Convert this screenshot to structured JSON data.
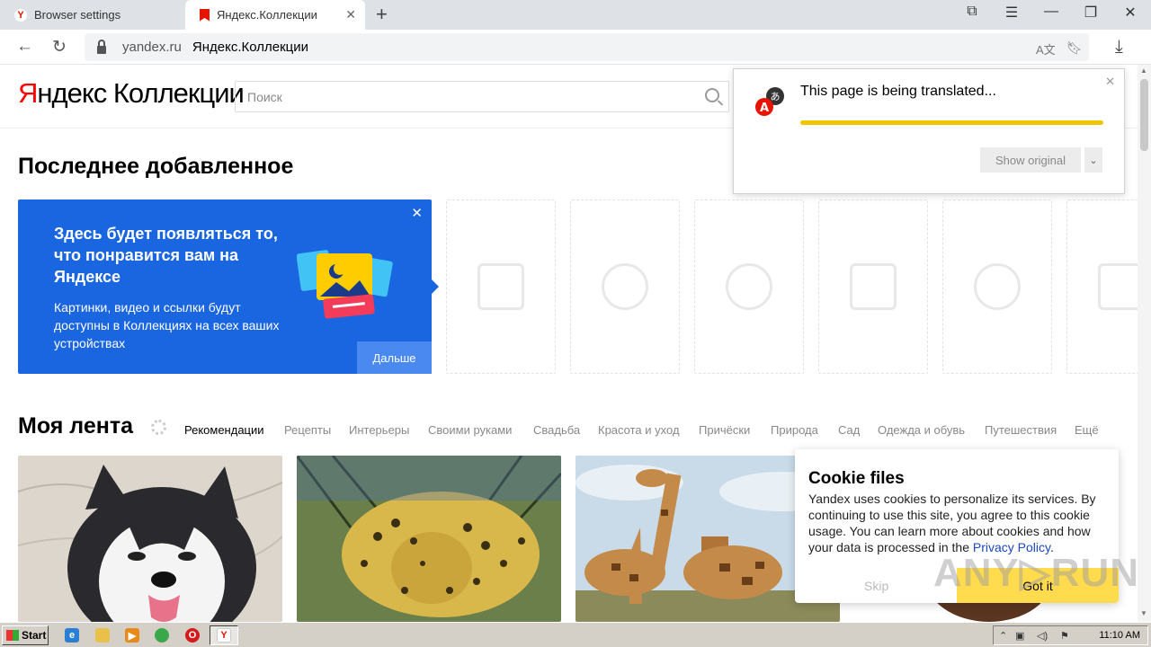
{
  "browser": {
    "tabs": [
      {
        "label": "Browser settings"
      },
      {
        "label": "Яндекс.Коллекции"
      }
    ],
    "new_tab": "+",
    "url_domain": "yandex.ru",
    "url_title": "Яндекс.Коллекции"
  },
  "header": {
    "logo_y": "Я",
    "logo_rest": "ндекс",
    "logo_collections": "Коллекции",
    "search_placeholder": "Поиск"
  },
  "recent": {
    "title": "Последнее добавленное",
    "promo_title": "Здесь будет появляться то, что понравится вам на Яндексе",
    "promo_text": "Картинки, видео и ссылки будут доступны в Коллекциях на всех ваших устройствах",
    "promo_button": "Дальше"
  },
  "feed": {
    "title": "Моя лента",
    "categories": [
      "Рекомендации",
      "Рецепты",
      "Интерьеры",
      "Своими руками",
      "Свадьба",
      "Красота и уход",
      "Причёски",
      "Природа",
      "Сад",
      "Одежда и обувь",
      "Путешествия",
      "Ещё"
    ]
  },
  "translate": {
    "title": "This page is being translated...",
    "show_original": "Show original",
    "progress": 1.0
  },
  "cookie": {
    "title": "Cookie files",
    "text": "Yandex uses cookies to personalize its services. By continuing to use this site, you agree to this cookie usage. You can learn more about cookies and how your data is processed in the ",
    "link": "Privacy Policy",
    "text_end": ".",
    "skip": "Skip",
    "got_it": "Got it"
  },
  "watermark": "ANY▷RUN",
  "taskbar": {
    "start": "Start",
    "clock": "11:10 AM"
  },
  "colors": {
    "promo_blue": "#1a66e0",
    "yandex_red": "#ff0000",
    "translate_bar": "#f0c500",
    "cookie_button": "#ffdb4d"
  }
}
